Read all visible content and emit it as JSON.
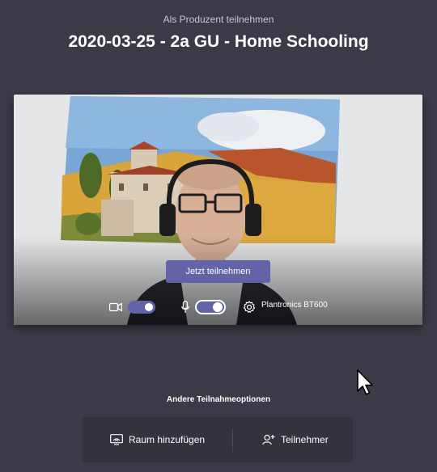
{
  "header": {
    "subtitle": "Als Produzent teilnehmen",
    "title": "2020-03-25 - 2a GU - Home Schooling"
  },
  "preview": {
    "join_button": "Jetzt teilnehmen",
    "camera_on": true,
    "mic_on": true,
    "audio_device": "Plantronics BT600"
  },
  "other_options": {
    "heading": "Andere Teilnahmeoptionen",
    "add_room": "Raum hinzufügen",
    "participants": "Teilnehmer"
  },
  "colors": {
    "background": "#3b3a47",
    "accent": "#6264a7",
    "options_bar": "#33323d"
  },
  "icons": [
    "camera-icon",
    "microphone-icon",
    "gear-icon",
    "cast-icon",
    "add-person-icon",
    "mouse-cursor-icon"
  ]
}
